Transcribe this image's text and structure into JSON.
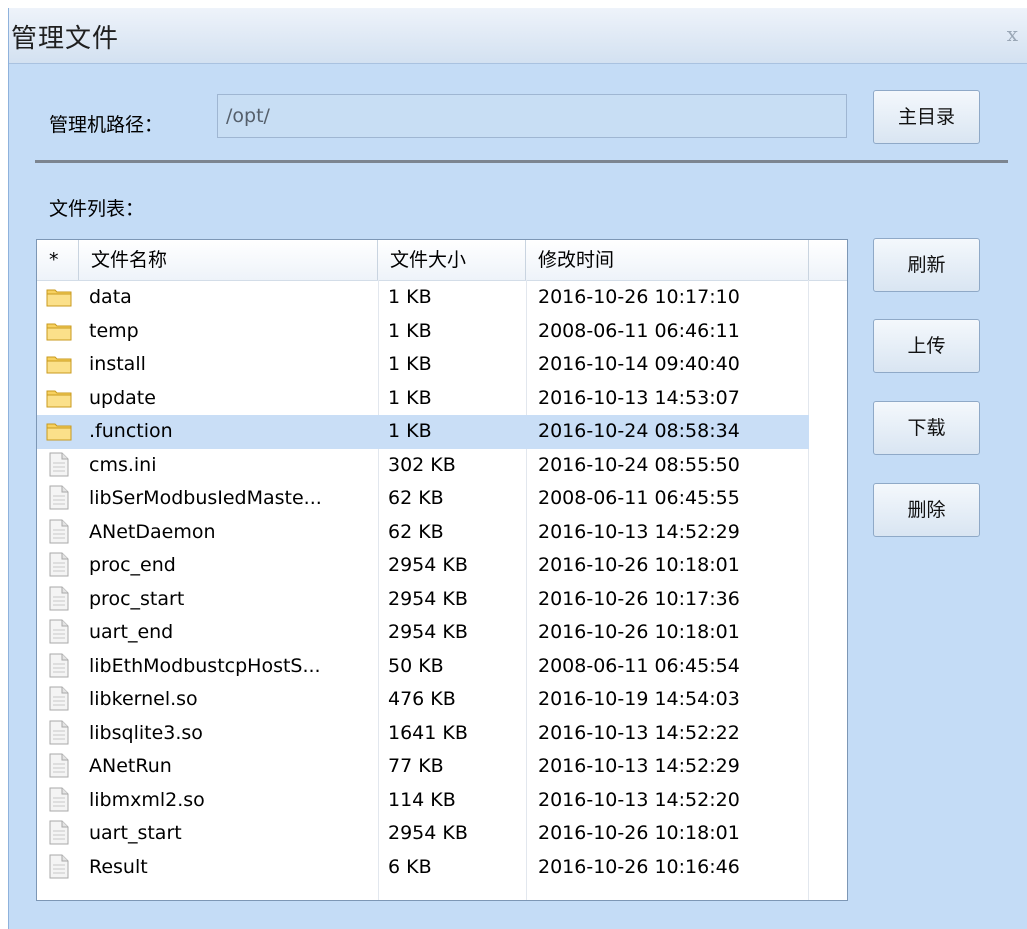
{
  "window": {
    "title": "管理文件",
    "close_glyph": "x"
  },
  "path": {
    "label": "管理机路径：",
    "value": "/opt/"
  },
  "buttons": {
    "home": "主目录",
    "refresh": "刷新",
    "upload": "上传",
    "download": "下载",
    "delete": "删除"
  },
  "file_list": {
    "label": "文件列表：",
    "columns": [
      "*",
      "文件名称",
      "文件大小",
      "修改时间"
    ],
    "selected_index": 4,
    "rows": [
      {
        "type": "folder",
        "name": "data",
        "size": "1 KB",
        "modified": "2016-10-26 10:17:10"
      },
      {
        "type": "folder",
        "name": "temp",
        "size": "1 KB",
        "modified": "2008-06-11 06:46:11"
      },
      {
        "type": "folder",
        "name": "install",
        "size": "1 KB",
        "modified": "2016-10-14 09:40:40"
      },
      {
        "type": "folder",
        "name": "update",
        "size": "1 KB",
        "modified": "2016-10-13 14:53:07"
      },
      {
        "type": "folder",
        "name": ".function",
        "size": "1 KB",
        "modified": "2016-10-24 08:58:34"
      },
      {
        "type": "file",
        "name": "cms.ini",
        "size": "302 KB",
        "modified": "2016-10-24 08:55:50"
      },
      {
        "type": "file",
        "name": "libSerModbusIedMaste...",
        "size": "62 KB",
        "modified": "2008-06-11 06:45:55"
      },
      {
        "type": "file",
        "name": "ANetDaemon",
        "size": "62 KB",
        "modified": "2016-10-13 14:52:29"
      },
      {
        "type": "file",
        "name": "proc_end",
        "size": "2954 KB",
        "modified": "2016-10-26 10:18:01"
      },
      {
        "type": "file",
        "name": "proc_start",
        "size": "2954 KB",
        "modified": "2016-10-26 10:17:36"
      },
      {
        "type": "file",
        "name": "uart_end",
        "size": "2954 KB",
        "modified": "2016-10-26 10:18:01"
      },
      {
        "type": "file",
        "name": "libEthModbustcpHostS...",
        "size": "50 KB",
        "modified": "2008-06-11 06:45:54"
      },
      {
        "type": "file",
        "name": "libkernel.so",
        "size": "476 KB",
        "modified": "2016-10-19 14:54:03"
      },
      {
        "type": "file",
        "name": "libsqlite3.so",
        "size": "1641 KB",
        "modified": "2016-10-13 14:52:22"
      },
      {
        "type": "file",
        "name": "ANetRun",
        "size": "77 KB",
        "modified": "2016-10-13 14:52:29"
      },
      {
        "type": "file",
        "name": "libmxml2.so",
        "size": "114 KB",
        "modified": "2016-10-13 14:52:20"
      },
      {
        "type": "file",
        "name": "uart_start",
        "size": "2954 KB",
        "modified": "2016-10-26 10:18:01"
      },
      {
        "type": "file",
        "name": "Result",
        "size": "6 KB",
        "modified": "2016-10-26 10:16:46"
      }
    ]
  },
  "icons": {
    "folder": "folder-icon",
    "file": "file-icon"
  },
  "colors": {
    "dialog_bg": "#c4dcf6",
    "selected_row": "#c9def6",
    "folder": "#f5c542"
  }
}
